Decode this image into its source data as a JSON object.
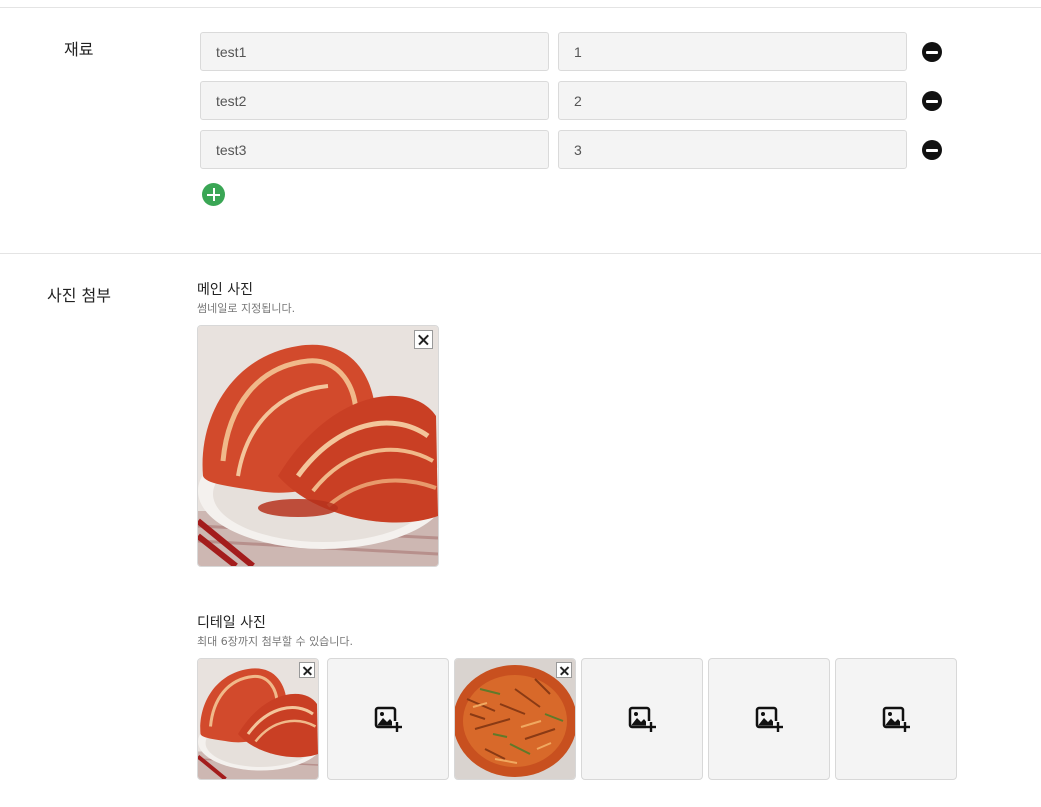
{
  "ingredients": {
    "label": "재료",
    "rows": [
      {
        "name": "test1",
        "amount": "1"
      },
      {
        "name": "test2",
        "amount": "2"
      },
      {
        "name": "test3",
        "amount": "3"
      }
    ],
    "remove_icon": "minus-circle-icon",
    "add_icon": "plus-circle-icon",
    "add_color": "#3aa655"
  },
  "photos": {
    "label": "사진 첨부",
    "main": {
      "title": "메인 사진",
      "description": "썸네일로 지정됩니다.",
      "image": "kimchi-photo"
    },
    "detail": {
      "title": "디테일 사진",
      "description": "최대 6장까지 첨부할 수 있습니다.",
      "slots": [
        {
          "state": "filled",
          "image": "kimchi-photo"
        },
        {
          "state": "empty",
          "icon": "add-photo-icon"
        },
        {
          "state": "filled",
          "image": "kimchi-pancake-photo"
        },
        {
          "state": "empty",
          "icon": "add-photo-icon"
        },
        {
          "state": "empty",
          "icon": "add-photo-icon"
        },
        {
          "state": "empty",
          "icon": "add-photo-icon"
        }
      ]
    },
    "close_icon": "close-icon"
  }
}
